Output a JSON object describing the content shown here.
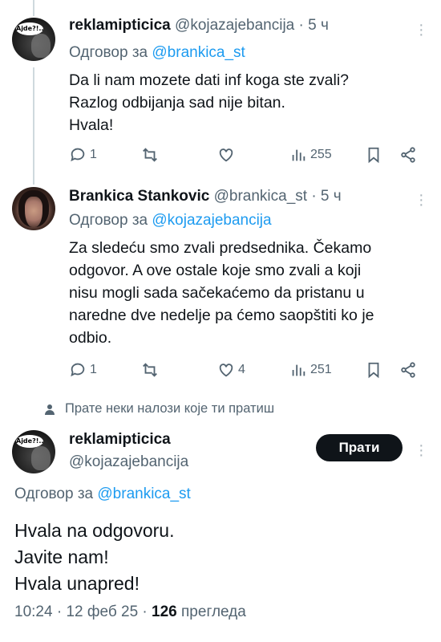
{
  "tweets": [
    {
      "display_name": "reklamipticica",
      "handle": "@kojazajebancija",
      "time": "· 5 ч",
      "reply_prefix": "Одговор за",
      "reply_to": "@brankica_st",
      "text_lines": [
        "Da li nam mozete dati inf koga ste zvali?",
        "Razlog odbijanja sad nije bitan.",
        "Hvala!"
      ],
      "replies": "1",
      "retweets": "",
      "likes": "",
      "views": "255",
      "avatar_text": "Ajde?!.."
    },
    {
      "display_name": "Brankica Stankovic",
      "handle": "@brankica_st",
      "time": "· 5 ч",
      "reply_prefix": "Одговор за",
      "reply_to": "@kojazajebancija",
      "text_lines": [
        "Za sledeću smo zvali predsednika. Čekamo",
        "odgovor. A ove ostale koje smo zvali a koji",
        "nisu mogli sada sačekaćemo da pristanu u",
        "naredne dve nedelje pa ćemo saopštiti ko je",
        "odbio."
      ],
      "replies": "1",
      "retweets": "",
      "likes": "4",
      "views": "251"
    }
  ],
  "social_context": "Прате неки налози које ти пратиш",
  "main_tweet": {
    "display_name": "reklamipticica",
    "handle": "@kojazajebancija",
    "follow_label": "Прати",
    "reply_prefix": "Одговор за",
    "reply_to": "@brankica_st",
    "text_lines": [
      "Hvala na odgovoru.",
      "Javite nam!",
      "Hvala unapred!"
    ],
    "time": "10:24",
    "date": "12 феб 25",
    "views_count": "126",
    "views_label": "прегледа",
    "avatar_text": "Ajde?!.."
  }
}
